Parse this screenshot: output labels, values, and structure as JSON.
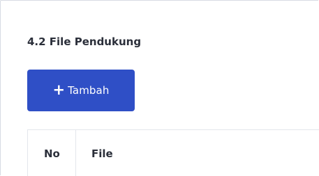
{
  "section": {
    "title": "4.2 File Pendukung"
  },
  "add_button": {
    "icon": "plus-icon",
    "icon_glyph": "+",
    "label": "Tambah",
    "color": "#2f4fc6"
  },
  "table": {
    "columns": [
      "No",
      "File"
    ]
  }
}
